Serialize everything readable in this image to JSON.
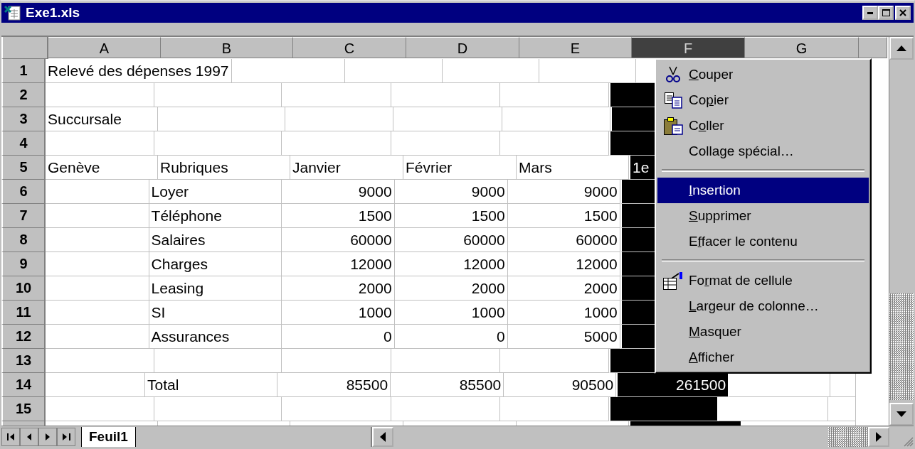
{
  "window": {
    "title": "Exe1.xls"
  },
  "columns": [
    {
      "label": "A",
      "selected": false
    },
    {
      "label": "B",
      "selected": false
    },
    {
      "label": "C",
      "selected": false
    },
    {
      "label": "D",
      "selected": false
    },
    {
      "label": "E",
      "selected": false
    },
    {
      "label": "F",
      "selected": true
    },
    {
      "label": "G",
      "selected": false
    }
  ],
  "rows": [
    {
      "number": "1",
      "cells": [
        {
          "text": "Relevé des dépenses 1997",
          "kind": "text"
        },
        null,
        null,
        null,
        null,
        null,
        null
      ]
    },
    {
      "number": "2",
      "cells": [
        null,
        null,
        null,
        null,
        null,
        null,
        null
      ]
    },
    {
      "number": "3",
      "cells": [
        {
          "text": "Succursale",
          "kind": "text"
        },
        null,
        null,
        null,
        null,
        null,
        null
      ]
    },
    {
      "number": "4",
      "cells": [
        null,
        null,
        null,
        null,
        null,
        null,
        null
      ]
    },
    {
      "number": "5",
      "cells": [
        {
          "text": "Genève",
          "kind": "text"
        },
        {
          "text": "Rubriques",
          "kind": "text"
        },
        {
          "text": "Janvier",
          "kind": "text"
        },
        {
          "text": "Février",
          "kind": "text"
        },
        {
          "text": "Mars",
          "kind": "text"
        },
        {
          "text": "1e",
          "kind": "text"
        },
        null
      ]
    },
    {
      "number": "6",
      "cells": [
        null,
        {
          "text": "Loyer",
          "kind": "text"
        },
        {
          "text": "9000",
          "kind": "number"
        },
        {
          "text": "9000",
          "kind": "number"
        },
        {
          "text": "9000",
          "kind": "number"
        },
        null,
        null
      ]
    },
    {
      "number": "7",
      "cells": [
        null,
        {
          "text": "Téléphone",
          "kind": "text"
        },
        {
          "text": "1500",
          "kind": "number"
        },
        {
          "text": "1500",
          "kind": "number"
        },
        {
          "text": "1500",
          "kind": "number"
        },
        null,
        null
      ]
    },
    {
      "number": "8",
      "cells": [
        null,
        {
          "text": "Salaires",
          "kind": "text"
        },
        {
          "text": "60000",
          "kind": "number"
        },
        {
          "text": "60000",
          "kind": "number"
        },
        {
          "text": "60000",
          "kind": "number"
        },
        null,
        null
      ]
    },
    {
      "number": "9",
      "cells": [
        null,
        {
          "text": "Charges",
          "kind": "text"
        },
        {
          "text": "12000",
          "kind": "number"
        },
        {
          "text": "12000",
          "kind": "number"
        },
        {
          "text": "12000",
          "kind": "number"
        },
        null,
        null
      ]
    },
    {
      "number": "10",
      "cells": [
        null,
        {
          "text": "Leasing",
          "kind": "text"
        },
        {
          "text": "2000",
          "kind": "number"
        },
        {
          "text": "2000",
          "kind": "number"
        },
        {
          "text": "2000",
          "kind": "number"
        },
        null,
        null
      ]
    },
    {
      "number": "11",
      "cells": [
        null,
        {
          "text": "SI",
          "kind": "text"
        },
        {
          "text": "1000",
          "kind": "number"
        },
        {
          "text": "1000",
          "kind": "number"
        },
        {
          "text": "1000",
          "kind": "number"
        },
        null,
        null
      ]
    },
    {
      "number": "12",
      "cells": [
        null,
        {
          "text": "Assurances",
          "kind": "text"
        },
        {
          "text": "0",
          "kind": "number"
        },
        {
          "text": "0",
          "kind": "number"
        },
        {
          "text": "5000",
          "kind": "number"
        },
        null,
        null
      ]
    },
    {
      "number": "13",
      "cells": [
        null,
        null,
        null,
        null,
        null,
        null,
        null
      ]
    },
    {
      "number": "14",
      "cells": [
        null,
        {
          "text": "Total",
          "kind": "text"
        },
        {
          "text": "85500",
          "kind": "number"
        },
        {
          "text": "85500",
          "kind": "number"
        },
        {
          "text": "90500",
          "kind": "number"
        },
        {
          "text": "261500",
          "kind": "number"
        },
        null
      ]
    },
    {
      "number": "15",
      "cells": [
        null,
        null,
        null,
        null,
        null,
        null,
        null
      ]
    }
  ],
  "context_menu": [
    {
      "kind": "cut",
      "key": "C",
      "post": "ouper",
      "selected": false
    },
    {
      "kind": "copy",
      "pre": "Co",
      "key": "p",
      "post": "ier",
      "selected": false
    },
    {
      "kind": "paste",
      "pre": "C",
      "key": "o",
      "post": "ller",
      "selected": false
    },
    {
      "kind": "item",
      "pre": "Collage spécial…",
      "selected": false
    },
    {
      "kind": "separator"
    },
    {
      "kind": "item",
      "key": "I",
      "post": "nsertion",
      "selected": true
    },
    {
      "kind": "item",
      "key": "S",
      "post": "upprimer",
      "selected": false
    },
    {
      "kind": "item",
      "pre": "E",
      "key": "f",
      "post": "facer le contenu",
      "selected": false
    },
    {
      "kind": "separator"
    },
    {
      "kind": "format",
      "pre": "Fo",
      "key": "r",
      "post": "mat de cellule",
      "selected": false
    },
    {
      "kind": "item",
      "key": "L",
      "post": "argeur de colonne…",
      "selected": false
    },
    {
      "kind": "item",
      "key": "M",
      "post": "asquer",
      "selected": false
    },
    {
      "kind": "item",
      "key": "A",
      "post": "fficher",
      "selected": false
    }
  ],
  "sheet_tabs": [
    {
      "label": "Feuil1",
      "selected": true
    }
  ]
}
